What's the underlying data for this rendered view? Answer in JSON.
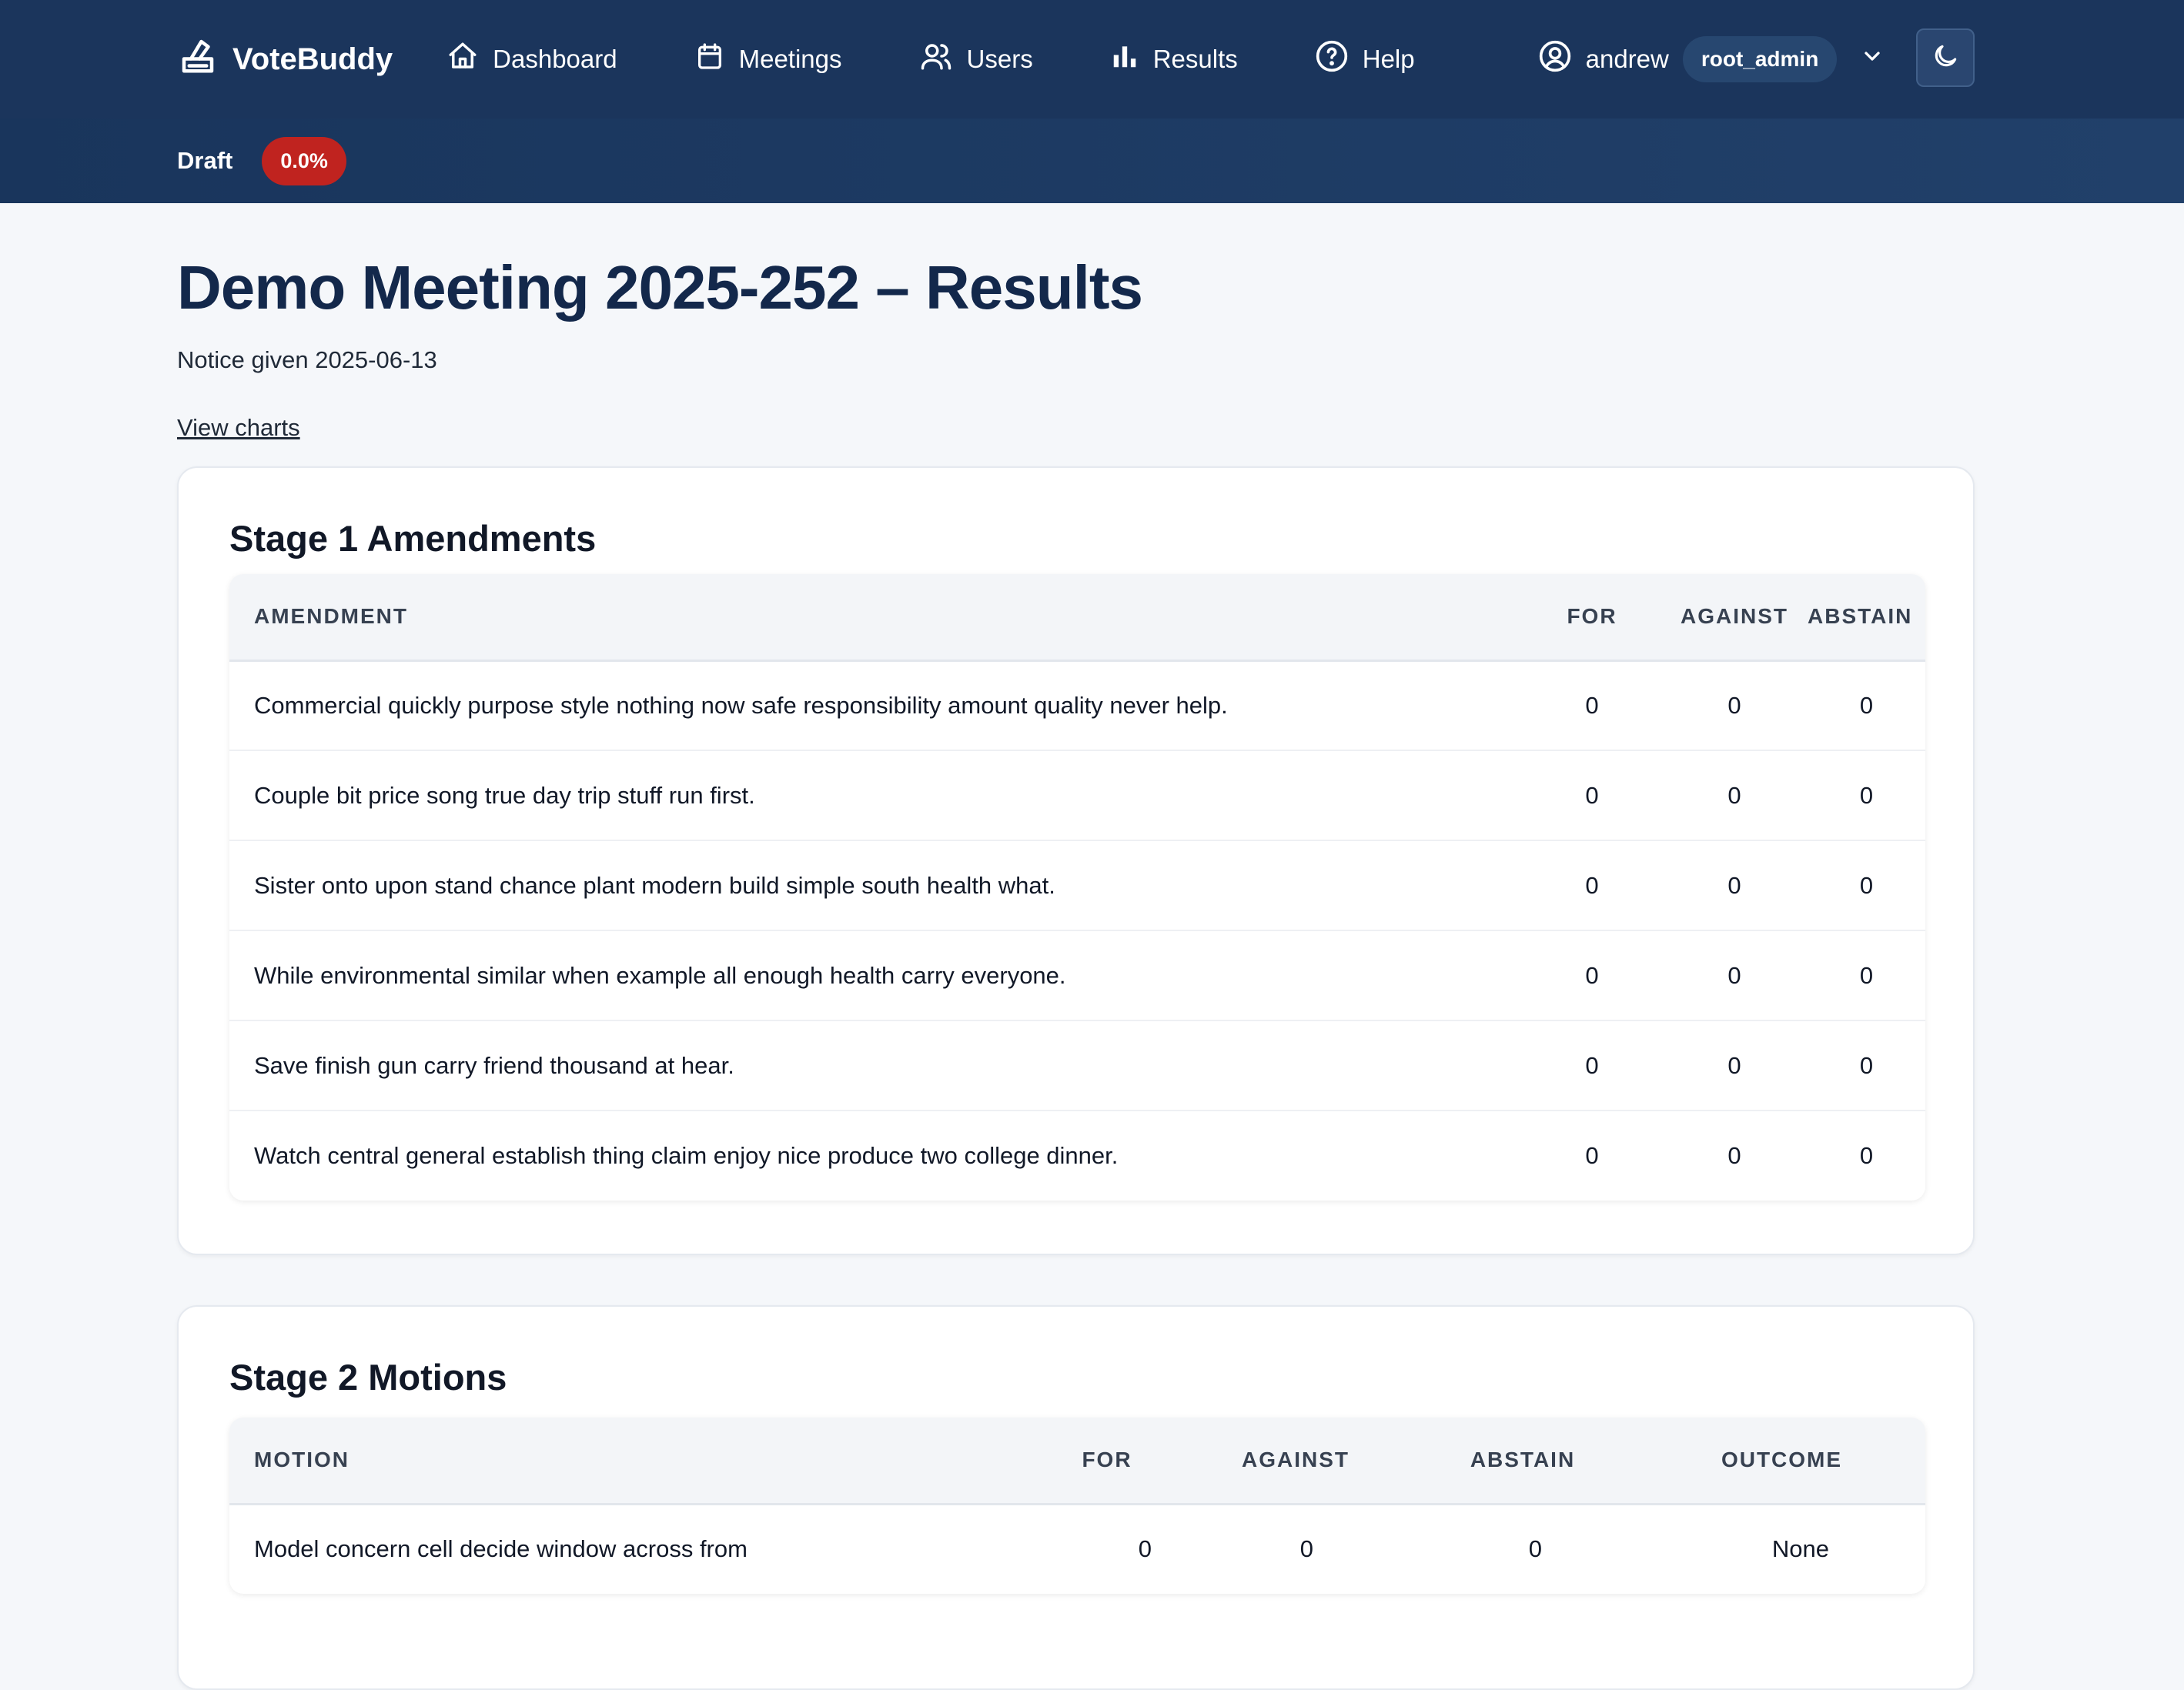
{
  "nav": {
    "brand": "VoteBuddy",
    "items": [
      {
        "label": "Dashboard",
        "icon": "home-icon"
      },
      {
        "label": "Meetings",
        "icon": "calendar-icon"
      },
      {
        "label": "Users",
        "icon": "users-icon"
      },
      {
        "label": "Results",
        "icon": "bar-chart-icon"
      },
      {
        "label": "Help",
        "icon": "help-circle-icon"
      }
    ],
    "user": {
      "name": "andrew",
      "role": "root_admin"
    },
    "theme_toggle_icon": "moon-icon"
  },
  "status": {
    "label": "Draft",
    "progress": "0.0%",
    "progress_color": "#c0231f"
  },
  "page": {
    "title": "Demo Meeting 2025-252 – Results",
    "notice": "Notice given 2025-06-13",
    "view_charts": "View charts"
  },
  "stage1": {
    "title": "Stage 1 Amendments",
    "headers": [
      "AMENDMENT",
      "FOR",
      "AGAINST",
      "ABSTAIN"
    ],
    "rows": [
      {
        "text": "Commercial quickly purpose style nothing now safe responsibility amount quality never help.",
        "for": "0",
        "against": "0",
        "abstain": "0"
      },
      {
        "text": "Couple bit price song true day trip stuff run first.",
        "for": "0",
        "against": "0",
        "abstain": "0"
      },
      {
        "text": "Sister onto upon stand chance plant modern build simple south health what.",
        "for": "0",
        "against": "0",
        "abstain": "0"
      },
      {
        "text": "While environmental similar when example all enough health carry everyone.",
        "for": "0",
        "against": "0",
        "abstain": "0"
      },
      {
        "text": "Save finish gun carry friend thousand at hear.",
        "for": "0",
        "against": "0",
        "abstain": "0"
      },
      {
        "text": "Watch central general establish thing claim enjoy nice produce two college dinner.",
        "for": "0",
        "against": "0",
        "abstain": "0"
      }
    ]
  },
  "stage2": {
    "title": "Stage 2 Motions",
    "headers": [
      "MOTION",
      "FOR",
      "AGAINST",
      "ABSTAIN",
      "OUTCOME"
    ],
    "rows": [
      {
        "text": "Model concern cell decide window across from",
        "for": "0",
        "against": "0",
        "abstain": "0",
        "outcome": "None"
      }
    ]
  }
}
